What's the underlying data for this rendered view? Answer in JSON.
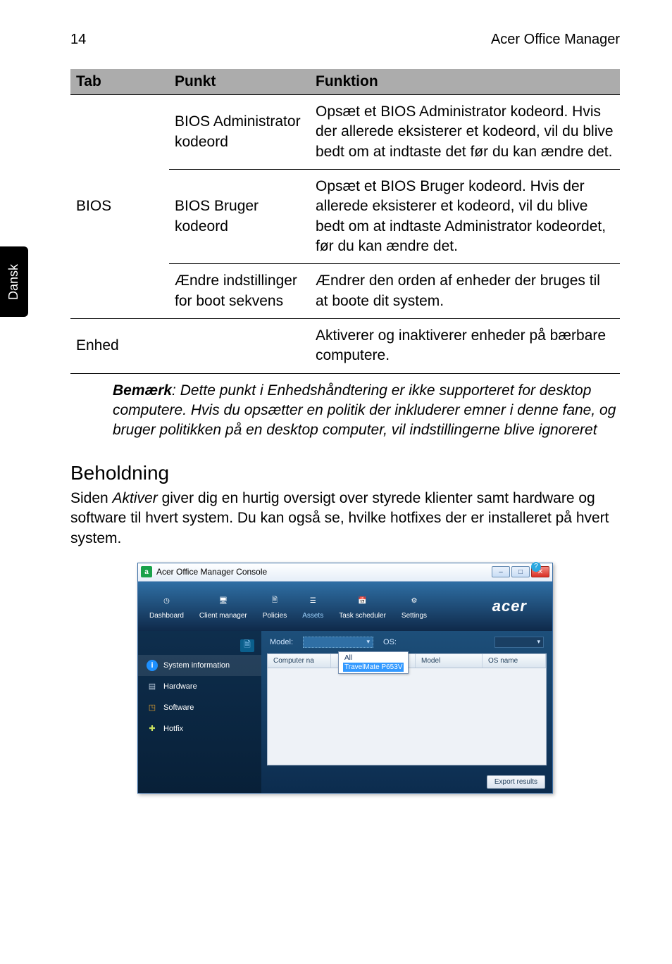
{
  "page": {
    "number": "14",
    "app": "Acer Office Manager",
    "side_language": "Dansk"
  },
  "table": {
    "head": {
      "c1": "Tab",
      "c2": "Punkt",
      "c3": "Funktion"
    },
    "bios_group_label": "BIOS",
    "rows": [
      {
        "punkt": "BIOS Administrator kodeord",
        "funktion": "Opsæt et BIOS Administrator kodeord. Hvis der allerede eksisterer et kodeord, vil du blive bedt om at indtaste det før du kan ændre det."
      },
      {
        "punkt": "BIOS Bruger kodeord",
        "funktion": "Opsæt et BIOS Bruger kodeord. Hvis der allerede eksisterer et kodeord, vil du blive bedt om at indtaste Administrator kodeordet, før du kan ændre det."
      },
      {
        "punkt": "Ændre indstillinger for boot sekvens",
        "funktion": "Ændrer den orden af enheder der bruges til at boote dit system."
      }
    ],
    "enhed": {
      "tab": "Enhed",
      "punkt": "",
      "funktion": "Aktiverer og inaktiverer enheder på bærbare computere."
    }
  },
  "note": {
    "bold": "Bemærk",
    "text": ": Dette punkt i Enhedshåndtering er ikke supporteret for desktop computere. Hvis du opsætter en politik der inkluderer emner i denne fane, og bruger politikken på en desktop computer, vil indstillingerne blive ignoreret"
  },
  "section": {
    "heading": "Beholdning",
    "body_pre": "Siden ",
    "body_em": "Aktiver",
    "body_post": " giver dig en hurtig oversigt over styrede klienter samt hardware og software til hvert system. Du kan også se, hvilke hotfixes der er installeret på hvert system."
  },
  "shot": {
    "title": "Acer Office Manager Console",
    "ribbon": {
      "items": [
        "Dashboard",
        "Client manager",
        "Policies",
        "Assets",
        "Task scheduler",
        "Settings"
      ],
      "brand": "acer"
    },
    "sidebar": {
      "items": [
        "System information",
        "Hardware",
        "Software",
        "Hotfix"
      ]
    },
    "filters": {
      "model_label": "Model:",
      "os_label": "OS:",
      "dropdown_all": "All",
      "dropdown_option": "TravelMate P653V"
    },
    "grid": {
      "cols": [
        "Computer na",
        "",
        "Model",
        "OS name"
      ]
    },
    "export": "Export results"
  }
}
